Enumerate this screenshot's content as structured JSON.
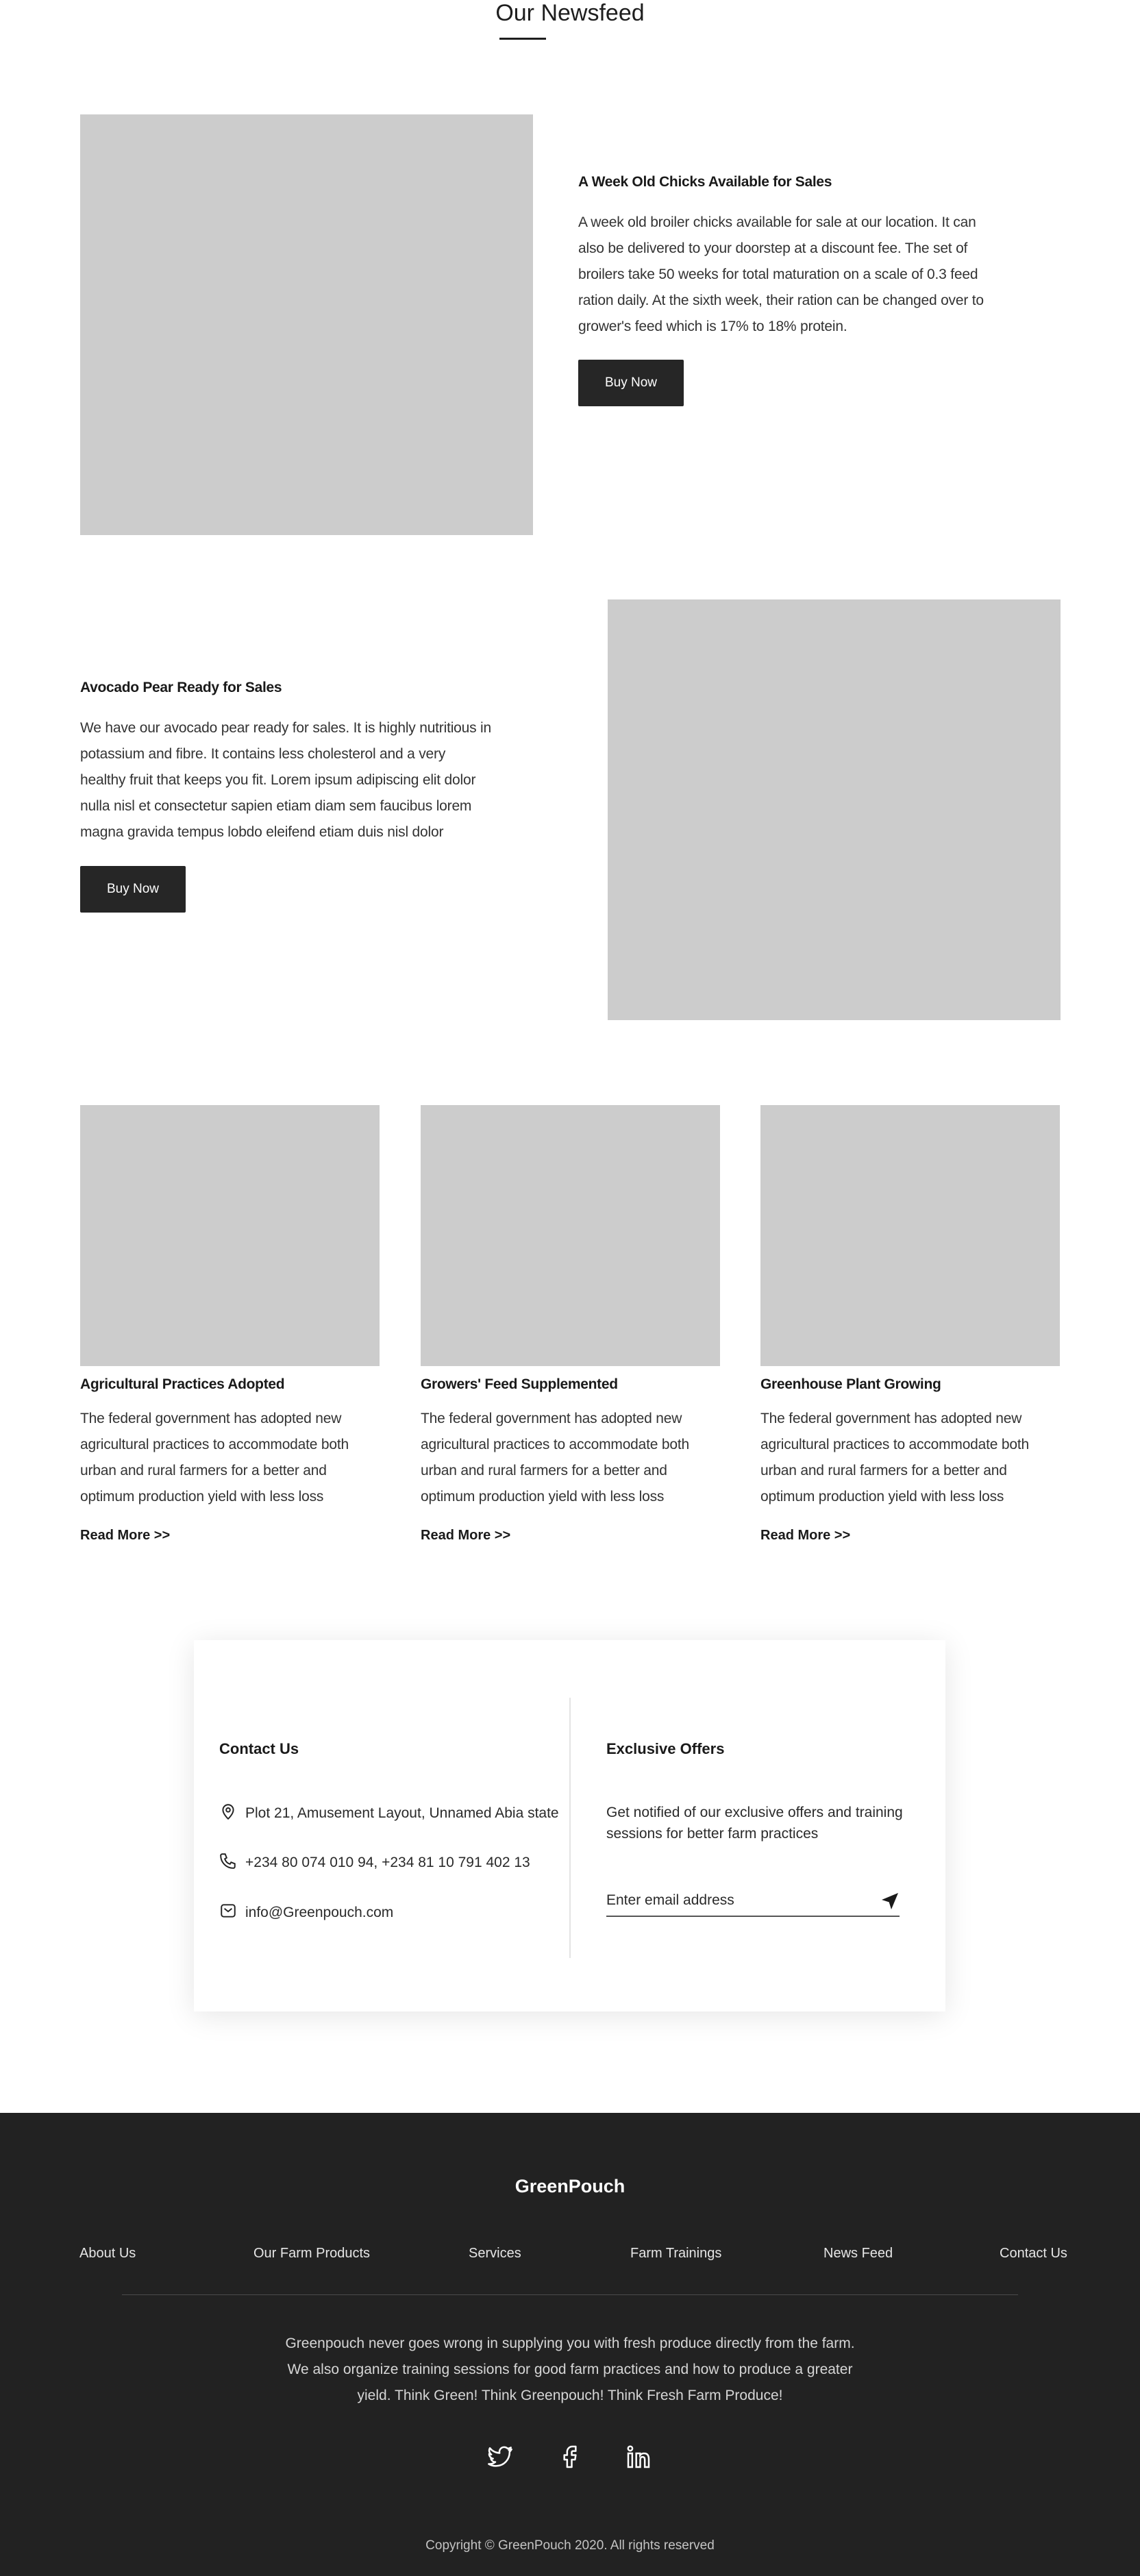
{
  "newsfeed": {
    "title": "Our Newsfeed"
  },
  "features": [
    {
      "title": "A Week Old Chicks Available for Sales",
      "text": "A week old broiler chicks available for sale at our location. It can also be delivered to your doorstep at a discount fee. The set of broilers take 50 weeks for total maturation on a scale of 0.3 feed ration daily. At the sixth week, their ration can be changed over to grower's feed which is 17% to 18% protein.",
      "button": "Buy Now"
    },
    {
      "title": "Avocado Pear Ready for Sales",
      "text": "We have our avocado pear ready for sales. It is highly nutritious in potassium and fibre. It contains less cholesterol and a very healthy fruit that keeps you fit. Lorem ipsum adipiscing elit dolor nulla nisl et consectetur sapien etiam diam sem faucibus lorem magna gravida tempus lobdo eleifend etiam duis nisl dolor elementum.",
      "button": "Buy Now"
    }
  ],
  "cards": [
    {
      "title": "Agricultural Practices Adopted",
      "text": "The federal government has adopted new agricultural practices to accommodate both urban and rural farmers for a better and optimum production yield with less loss",
      "link": "Read More >>"
    },
    {
      "title": "Growers' Feed Supplemented",
      "text": "The federal government has adopted new agricultural practices to accommodate both urban and rural farmers for a better and optimum production yield with less loss",
      "link": "Read More >>"
    },
    {
      "title": "Greenhouse Plant Growing",
      "text": "The federal government has adopted new agricultural practices to accommodate both urban and rural farmers for a better and optimum production yield with less loss",
      "link": "Read More >>"
    }
  ],
  "contact": {
    "heading": "Contact Us",
    "address": "Plot 21, Amusement Layout, Unnamed Abia state",
    "phone": "+234 80 074 010 94, +234 81 10 791 402 13",
    "email": "info@Greenpouch.com"
  },
  "offers": {
    "heading": "Exclusive Offers",
    "text": "Get notified of our exclusive offers and training sessions for better farm practices",
    "email_placeholder": "Enter email address"
  },
  "footer": {
    "logo": "GreenPouch",
    "nav": [
      "About Us",
      "Our Farm Products",
      "Services",
      "Farm Trainings",
      "News Feed",
      "Contact Us"
    ],
    "about": "Greenpouch never goes wrong in supplying you with fresh produce directly from the farm. We also organize training sessions for good farm practices and how to produce a greater yield. Think Green! Think Greenpouch! Think Fresh Farm Produce!",
    "copyright": "Copyright © GreenPouch 2020. All rights reserved"
  },
  "icons": {
    "social": [
      "twitter-icon",
      "facebook-icon",
      "linkedin-icon"
    ],
    "contact": [
      "location-pin-icon",
      "phone-icon",
      "mail-icon"
    ],
    "submit": "send-icon"
  },
  "colors": {
    "button": "#262626",
    "footer_bg": "#222222",
    "placeholder": "#cccccc"
  }
}
